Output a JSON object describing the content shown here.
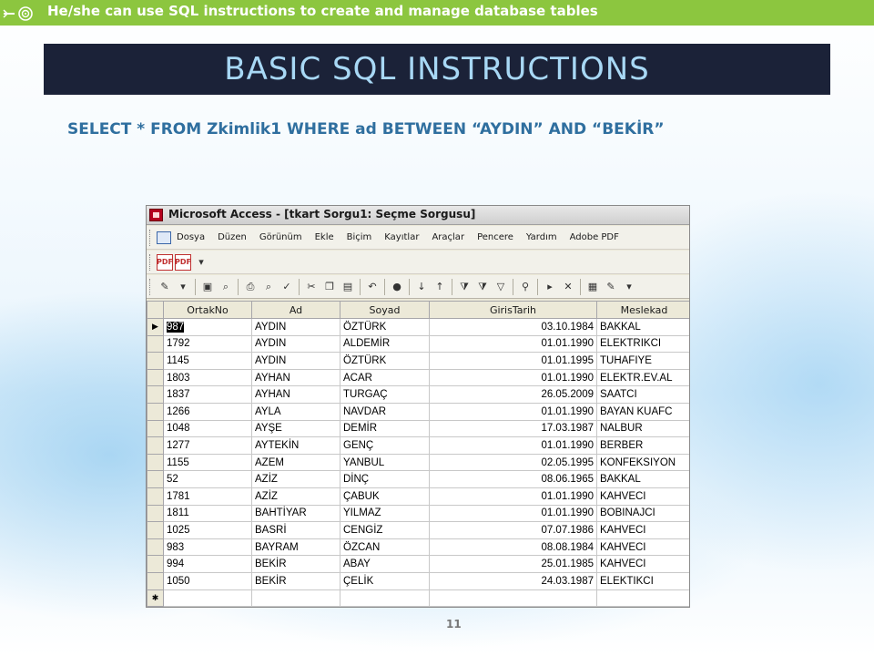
{
  "banner": {
    "text": "He/she can use SQL instructions to create and manage database tables"
  },
  "title": "BASIC SQL INSTRUCTIONS",
  "sql": "SELECT * FROM Zkimlik1 WHERE ad BETWEEN “AYDIN” AND “BEKİR”",
  "page_number": "11",
  "colors": {
    "banner": "#8cc63f",
    "title_bg": "#1b2238",
    "title_text": "#a8d8f5",
    "sql_text": "#2f6f9f"
  },
  "window": {
    "title": "Microsoft Access - [tkart Sorgu1: Seçme Sorgusu]",
    "menu": [
      "Dosya",
      "Düzen",
      "Görünüm",
      "Ekle",
      "Biçim",
      "Kayıtlar",
      "Araçlar",
      "Pencere",
      "Yardım",
      "Adobe PDF"
    ]
  },
  "table": {
    "columns": [
      "OrtakNo",
      "Ad",
      "Soyad",
      "GirisTarih",
      "Meslekad"
    ],
    "rows": [
      [
        "987",
        "AYDIN",
        "ÖZTÜRK",
        "03.10.1984",
        "BAKKAL"
      ],
      [
        "1792",
        "AYDIN",
        "ALDEMİR",
        "01.01.1990",
        "ELEKTRIKCI"
      ],
      [
        "1145",
        "AYDIN",
        "ÖZTÜRK",
        "01.01.1995",
        "TUHAFIYE"
      ],
      [
        "1803",
        "AYHAN",
        "ACAR",
        "01.01.1990",
        "ELEKTR.EV.AL"
      ],
      [
        "1837",
        "AYHAN",
        "TURGAÇ",
        "26.05.2009",
        "SAATCI"
      ],
      [
        "1266",
        "AYLA",
        "NAVDAR",
        "01.01.1990",
        "BAYAN KUAFC"
      ],
      [
        "1048",
        "AYŞE",
        "DEMİR",
        "17.03.1987",
        "NALBUR"
      ],
      [
        "1277",
        "AYTEKİN",
        "GENÇ",
        "01.01.1990",
        "BERBER"
      ],
      [
        "1155",
        "AZEM",
        "YANBUL",
        "02.05.1995",
        "KONFEKSIYON"
      ],
      [
        "52",
        "AZİZ",
        "DİNÇ",
        "08.06.1965",
        "BAKKAL"
      ],
      [
        "1781",
        "AZİZ",
        "ÇABUK",
        "01.01.1990",
        "KAHVECI"
      ],
      [
        "1811",
        "BAHTİYAR",
        "YILMAZ",
        "01.01.1990",
        "BOBINAJCI"
      ],
      [
        "1025",
        "BASRİ",
        "CENGİZ",
        "07.07.1986",
        "KAHVECI"
      ],
      [
        "983",
        "BAYRAM",
        "ÖZCAN",
        "08.08.1984",
        "KAHVECI"
      ],
      [
        "994",
        "BEKİR",
        "ABAY",
        "25.01.1985",
        "KAHVECI"
      ],
      [
        "1050",
        "BEKİR",
        "ÇELİK",
        "24.03.1987",
        "ELEKTIKCI"
      ]
    ],
    "new_row_marker": "✱",
    "current_row_marker": "▶"
  }
}
